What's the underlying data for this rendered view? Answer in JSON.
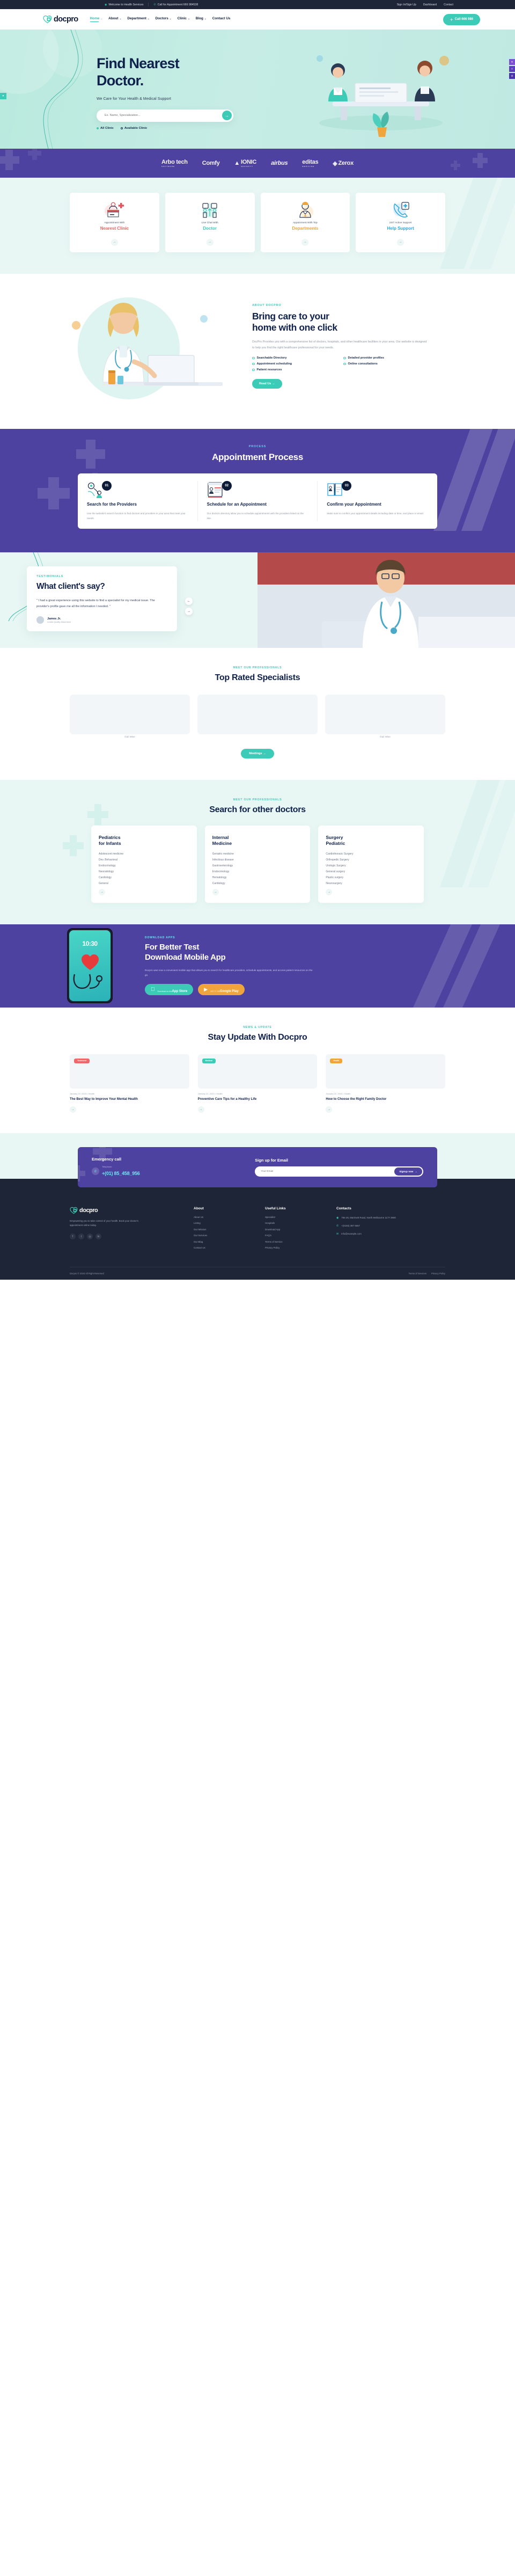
{
  "topbar": {
    "welcome": "Welcome to Health Services",
    "call": "Call for Appointment 666 984538",
    "links": [
      "Sign In/Sign Up",
      "Dashboard",
      "Contact"
    ]
  },
  "nav": {
    "brand": "docpro",
    "items": [
      {
        "label": "Home",
        "caret": true,
        "active": true
      },
      {
        "label": "About",
        "caret": true,
        "active": false
      },
      {
        "label": "Department",
        "caret": true,
        "active": false
      },
      {
        "label": "Doctors",
        "caret": true,
        "active": false
      },
      {
        "label": "Clinic",
        "caret": true,
        "active": false
      },
      {
        "label": "Blog",
        "caret": true,
        "active": false
      },
      {
        "label": "Contact Us",
        "caret": false,
        "active": false
      }
    ],
    "call_button": "Call 666 986"
  },
  "hero": {
    "title_line1": "Find Nearest",
    "title_line2": "Doctor.",
    "subtitle": "We Care for Your Health & Medical Support",
    "search_placeholder": "Ex. Name, Specialization...",
    "radio_all": "All Clinic",
    "radio_available": "Available Clinic"
  },
  "brands": [
    {
      "name": "Arbo tech",
      "sub": "SOFTWARE"
    },
    {
      "name": "Comfy",
      "sub": ""
    },
    {
      "name": "IONIC",
      "sub": "SECURITY"
    },
    {
      "name": "airbus",
      "sub": ""
    },
    {
      "name": "editas",
      "sub": "MEDICINE"
    },
    {
      "name": "Zerox",
      "sub": ""
    }
  ],
  "services": [
    {
      "top": "Appointment With",
      "name": "Nearest Clinic",
      "color": "#f4635f",
      "icon": "reception-desk-icon"
    },
    {
      "top": "Live Chat With",
      "name": "Doctor",
      "color": "#3ccbb7",
      "icon": "chat-people-icon"
    },
    {
      "top": "Appoinment With Top",
      "name": "Departments",
      "color": "#f0a53c",
      "icon": "doctor-person-icon"
    },
    {
      "top": "24/7 Active Support",
      "name": "Help Support",
      "color": "#2aa8e0",
      "icon": "phone-support-icon"
    }
  ],
  "about": {
    "eyebrow": "ABOUT DOCPRO",
    "title_line1": "Bring care to your",
    "title_line2": "home with one click",
    "paragraph": "DocPro Provides you with a comprehensive list of doctors, hospitals, and other healthcare facilities in your area. Our website is designed to help you find the right healthcare professional for your needs.",
    "features": [
      "Searchable Directory",
      "Detailed provider profiles",
      "Appointment scheduling",
      "Online consultations",
      "Patient resources"
    ],
    "button": "Read Us"
  },
  "process": {
    "eyebrow": "PROCESS",
    "title": "Appointment Process",
    "steps": [
      {
        "num": "01",
        "title": "Search for the Providers",
        "text": "Use the website's search function to find doctors and providers in your area that meet your needs."
      },
      {
        "num": "02",
        "title": "Schedule for an Appointment",
        "text": "Our doctors directory allow you to schedule appointments with the providers listed on the site."
      },
      {
        "num": "03",
        "title": "Confirm your Appointment",
        "text": "Make sure to confirm your appointment details including date or time, and place or email."
      }
    ]
  },
  "testimonials": {
    "eyebrow": "TESTIMONIALS",
    "title": "What client's say?",
    "quote": "\" I had a great experience using this website to find a specialist for my medical issue. The provider's profile gave me all the information I needed. \"",
    "author": "James Jr.",
    "role": "Leads Quality Assurance",
    "prev": "←",
    "next": "→"
  },
  "rated": {
    "eyebrow": "MEET OUR PROFESSIONALS",
    "title": "Top Rated Specialists",
    "doctors": [
      {
        "name": "",
        "spec": "Gail Wise"
      },
      {
        "name": "",
        "spec": ""
      },
      {
        "name": "",
        "spec": "Gail Wise"
      }
    ],
    "button": "Meetings"
  },
  "departments": {
    "eyebrow": "MEET OUR PROFESSIONALS",
    "title": "Search for other doctors",
    "cards": [
      {
        "title_l1": "Pediatrics",
        "title_l2": "for Infants",
        "items": [
          "Adolescent medicine",
          "Dev. Behavioral",
          "Endocrinology",
          "Neonatology",
          "Cardiology",
          "General"
        ]
      },
      {
        "title_l1": "Internal",
        "title_l2": "Medicine",
        "items": [
          "Geriatric medicine",
          "Infectious disease",
          "Gastroenterology",
          "Endocrinology",
          "Hematology",
          "Cardiology"
        ]
      },
      {
        "title_l1": "Surgery",
        "title_l2": "Pediatric",
        "items": [
          "Cardiothoracic Surgery",
          "Orthopedic Surgery",
          "Urologic Surgery",
          "General surgery",
          "Plastic surgery",
          "Neurosurgery"
        ]
      }
    ]
  },
  "app": {
    "eyebrow": "DOWNLOAD APPS",
    "title_line1": "For Better Test",
    "title_line2": "Download Mobile App",
    "paragraph": "Docpro was now a convenient mobile app that allows you to search for healthcare providers, schedule appointments, and access patient resources on the go.",
    "phone_time": "10:30",
    "stores": [
      {
        "small": "Download on the",
        "large": "App Store",
        "icon": "apple-icon"
      },
      {
        "small": "GET IT ON",
        "large": "Google Play",
        "icon": "google-play-icon"
      }
    ]
  },
  "blog": {
    "eyebrow": "NEWS & UPDATE",
    "title": "Stay Update With Docpro",
    "posts": [
      {
        "tag": "Treatment",
        "meta": "January 22, 2023  •  Health",
        "title": "The Best Way to Improve Your Mental Health"
      },
      {
        "tag": "Medical",
        "meta": "January 22, 2023  •  Health",
        "title": "Preventive Care Tips for a Healthy Life"
      },
      {
        "tag": "Health",
        "meta": "January 22, 2023  •  Health",
        "title": "How to Choose the Right Family Doctor"
      }
    ]
  },
  "cta": {
    "emergency_title": "Emergency call",
    "telephone_label": "Telephone",
    "phone": "+(01) 85_458_956",
    "signup_title": "Sign up for Email",
    "email_placeholder": "Your Email",
    "button": "Signup now"
  },
  "footer": {
    "brand": "docpro",
    "about_text": "Empowering you to take control of your health. Book your doctor's appointment online today.",
    "columns": [
      {
        "heading": "About",
        "items": [
          "About Us",
          "Listing",
          "Our Mission",
          "Our Services",
          "Our Blog",
          "Contact Us"
        ]
      },
      {
        "heading": "Useful Links",
        "items": [
          "Specialist",
          "Hospitals",
          "Download App",
          "FAQ's",
          "Terms of Service",
          "Privacy Policy"
        ]
      }
    ],
    "contacts_heading": "Contacts",
    "contacts": [
      {
        "icon": "map-pin-icon",
        "text": "756 25, Marrisett Road, North Melbourne 1177 3900"
      },
      {
        "icon": "phone-icon",
        "text": "+(0193) 387 5667"
      },
      {
        "icon": "mail-icon",
        "text": "info@example.com"
      }
    ],
    "copyright": "Docpro © 2023 All Right Reserved",
    "bottom_links": [
      "Terms of Services",
      "Privacy Policy"
    ]
  }
}
